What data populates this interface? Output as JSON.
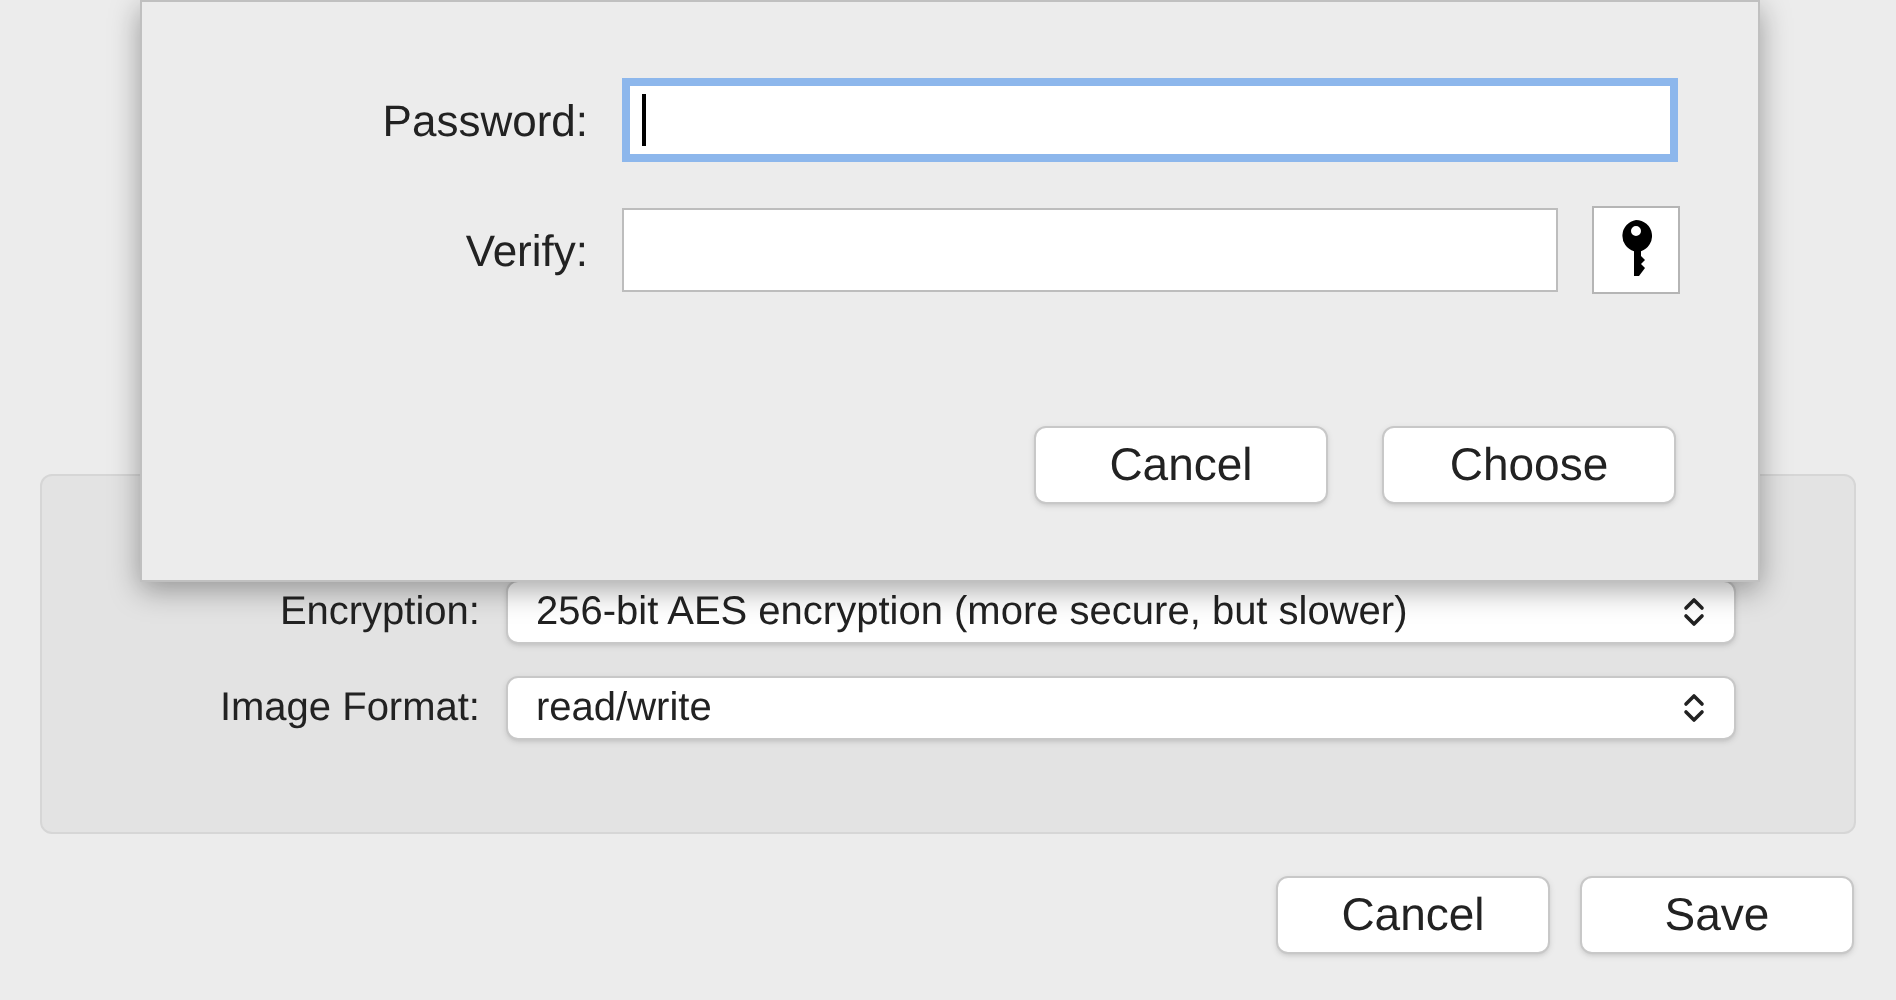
{
  "sheet": {
    "fields": [
      {
        "label": "Password:",
        "focused": true,
        "key_assistant": false
      },
      {
        "label": "Verify:",
        "focused": false,
        "key_assistant": true
      }
    ],
    "buttons": [
      "Cancel",
      "Choose"
    ]
  },
  "options": [
    {
      "label": "Encryption:",
      "value": "256-bit AES encryption (more secure, but slower)"
    },
    {
      "label": "Image Format:",
      "value": "read/write"
    }
  ],
  "buttons": [
    "Cancel",
    "Save"
  ]
}
